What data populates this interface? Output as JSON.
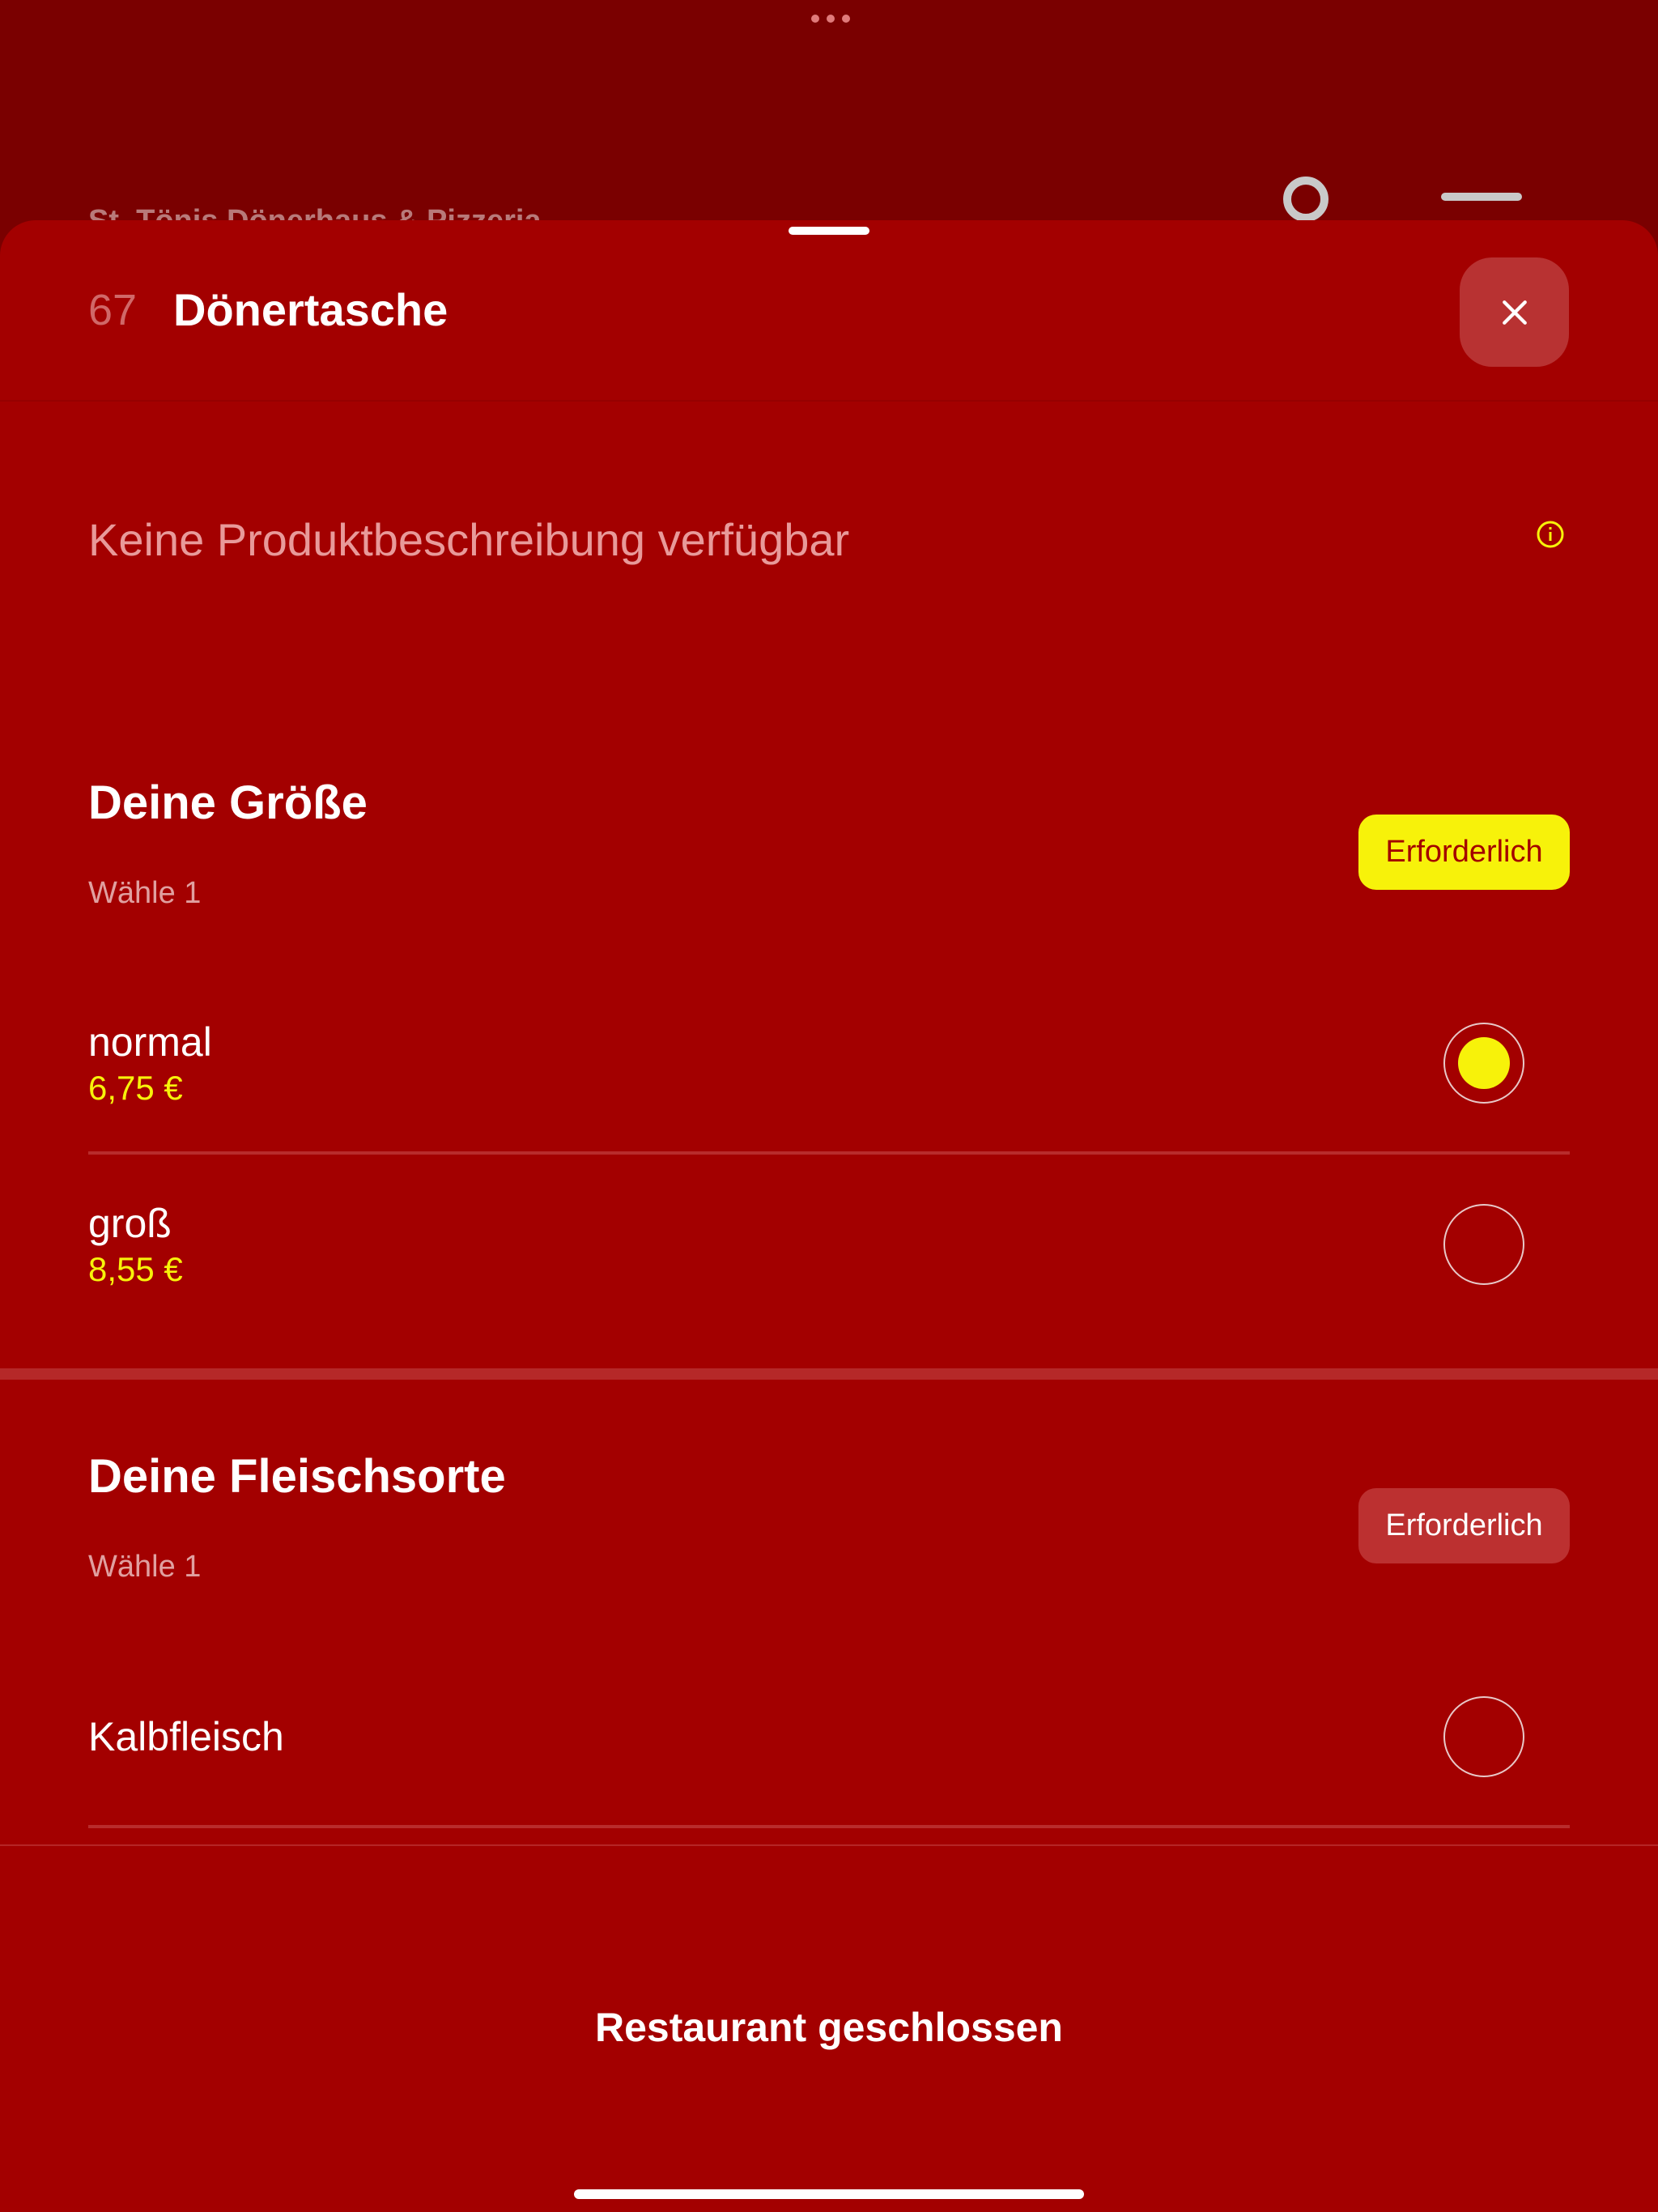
{
  "background_app": {
    "restaurant_name": "St. Tönis Dönerhaus & Pizzeria"
  },
  "item": {
    "number": "67",
    "title": "Dönertasche",
    "description": "Keine Produktbeschreibung verfügbar"
  },
  "groups": [
    {
      "title": "Deine Größe",
      "subtitle": "Wähle 1",
      "badge": "Erforderlich",
      "options": [
        {
          "name": "normal",
          "price": "6,75 €",
          "selected": true
        },
        {
          "name": "groß",
          "price": "8,55 €",
          "selected": false
        }
      ]
    },
    {
      "title": "Deine Fleischsorte",
      "subtitle": "Wähle 1",
      "badge": "Erforderlich",
      "options": [
        {
          "name": "Kalbfleisch",
          "selected": false
        }
      ]
    }
  ],
  "footer": {
    "status_label": "Restaurant geschlossen"
  },
  "colors": {
    "sheet_background": "#a30000",
    "accent_yellow": "#f7f20a",
    "badge_inactive": "#bc3030"
  },
  "icons": {
    "close": "close-icon",
    "info": "info-icon",
    "search": "search-icon",
    "menu": "menu-icon",
    "more": "more-dots-icon"
  }
}
